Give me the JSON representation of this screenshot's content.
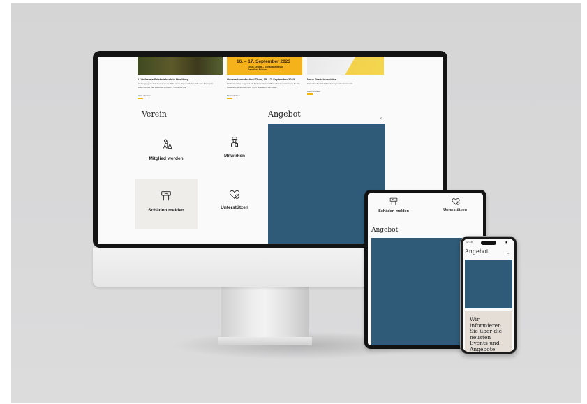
{
  "news": [
    {
      "title": "1. Viaferrata-Erlebnisbank in Hasliberg",
      "text": "Die Burgergemeinde Bern hat uns 2023 einen Preis verliehen. Mit dem Preisgeld stellen wir auf der Viaferrata Route 15 Sitzbänke auf.",
      "more": "Mehr erfahren"
    },
    {
      "title": "Generationenfestival Thun, 15.-17. September 2023",
      "text": "Ein Festival für Jung und Alt. Mehrere tausend Besucher:innen strömen für das Generationenfestival nach Thun. Sind auch Sie dabei?",
      "more": "Mehr erfahren",
      "poster": "16. – 17. September 2023",
      "poster_sub": [
        "Thun, Gwatt – Schadaustrasse",
        "Sandfest Bühne"
      ]
    },
    {
      "title": "Neue Gratisbroschüre",
      "text": "Erkunden Sie in 12 Wanderungen das Emmental.",
      "more": "Mehr erfahren"
    }
  ],
  "desktop": {
    "verein_heading": "Verein",
    "angebot_heading": "Angebot",
    "pager": "6/1",
    "tiles": [
      {
        "label": "Mitglied werden",
        "icon": "hiker-mountain-icon"
      },
      {
        "label": "Mitwirken",
        "icon": "volunteer-person-icon"
      },
      {
        "label": "Schäden melden",
        "icon": "signpost-icon"
      },
      {
        "label": "Unterstützen",
        "icon": "heart-hand-icon"
      }
    ],
    "panel_color": "#2f5b78",
    "tile_highlight_color": "#efedea"
  },
  "tablet": {
    "tile_left": "Schäden melden",
    "tile_right": "Unterstützen",
    "angebot_heading": "Angebot"
  },
  "phone": {
    "time": "17:19",
    "angebot_heading": "Angebot",
    "pager": "6/1",
    "promo_text": "Wir informieren Sie über die neusten Events und Angebote"
  }
}
